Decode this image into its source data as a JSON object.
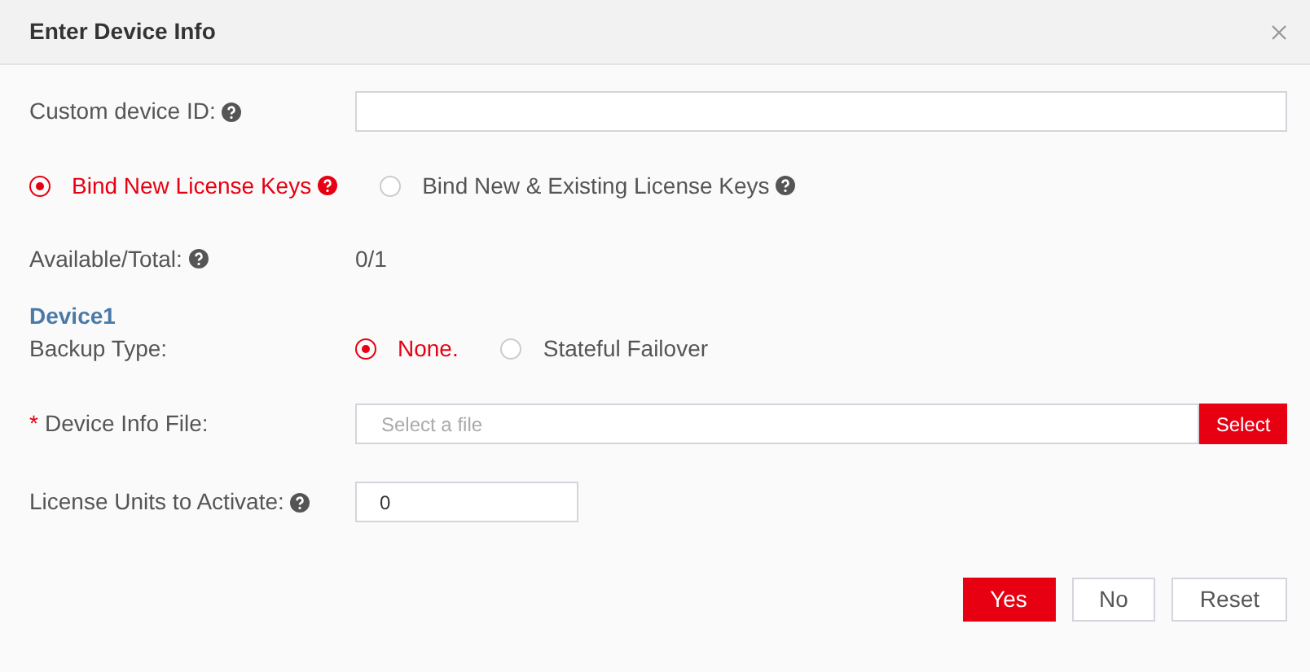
{
  "dialog": {
    "title": "Enter Device Info"
  },
  "custom_device_id": {
    "label": "Custom device ID:",
    "help": true
  },
  "bind_mode": [
    {
      "label": "Bind New License Keys",
      "selected": true,
      "help": true
    },
    {
      "label": "Bind New & Existing License Keys",
      "selected": false,
      "help": true
    }
  ],
  "available_total": {
    "label": "Available/Total:",
    "help": true,
    "value": "0/1"
  },
  "device": {
    "heading": "Device1",
    "backup_type": {
      "label": "Backup Type:",
      "options": [
        {
          "label": "None.",
          "selected": true
        },
        {
          "label": "Stateful Failover",
          "selected": false
        }
      ]
    },
    "device_info_file": {
      "label": "Device Info File:",
      "required_mark": "*",
      "placeholder": "Select a file",
      "button": "Select"
    },
    "license_units": {
      "label": "License Units to Activate:",
      "help": true,
      "value": "0"
    }
  },
  "buttons": [
    {
      "label": "Yes",
      "kind": "primary"
    },
    {
      "label": "No",
      "kind": "default"
    },
    {
      "label": "Reset",
      "kind": "default"
    }
  ]
}
